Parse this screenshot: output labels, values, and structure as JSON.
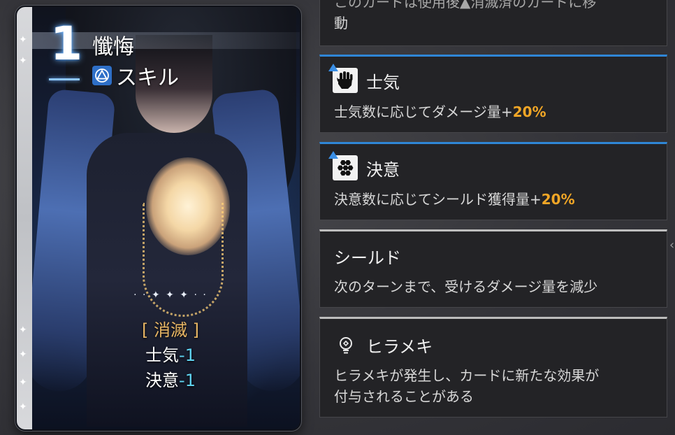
{
  "card": {
    "cost": "1",
    "name": "懺悔",
    "type_label": "スキル",
    "type_icon": "skill-triangle-icon",
    "effect_tag": "[ 消滅 ]",
    "effects": [
      {
        "label": "士気",
        "value": "-1"
      },
      {
        "label": "決意",
        "value": "-1"
      }
    ]
  },
  "panels": {
    "partial_top": {
      "line1": "このカードは使用後▲消滅済のカードに移",
      "line2": "動"
    },
    "morale": {
      "icon": "fist-icon",
      "title": "士気",
      "desc_prefix": "士気数に応じてダメージ量+",
      "desc_value": "20%"
    },
    "resolve": {
      "icon": "hexagon-shield-icon",
      "title": "決意",
      "desc_prefix": "決意数に応じてシールド獲得量+",
      "desc_value": "20%"
    },
    "shield": {
      "title": "シールド",
      "desc": "次のターンまで、受けるダメージ量を減少"
    },
    "inspiration": {
      "icon": "lightbulb-icon",
      "title": "ヒラメキ",
      "desc_line1": "ヒラメキが発生し、カードに新たな効果が",
      "desc_line2": "付与されることがある"
    }
  },
  "colors": {
    "accent_blue": "#2f86d6",
    "highlight_orange": "#f0a626",
    "effect_tag_gold": "#e8b664",
    "value_cyan": "#5fd3f0"
  }
}
